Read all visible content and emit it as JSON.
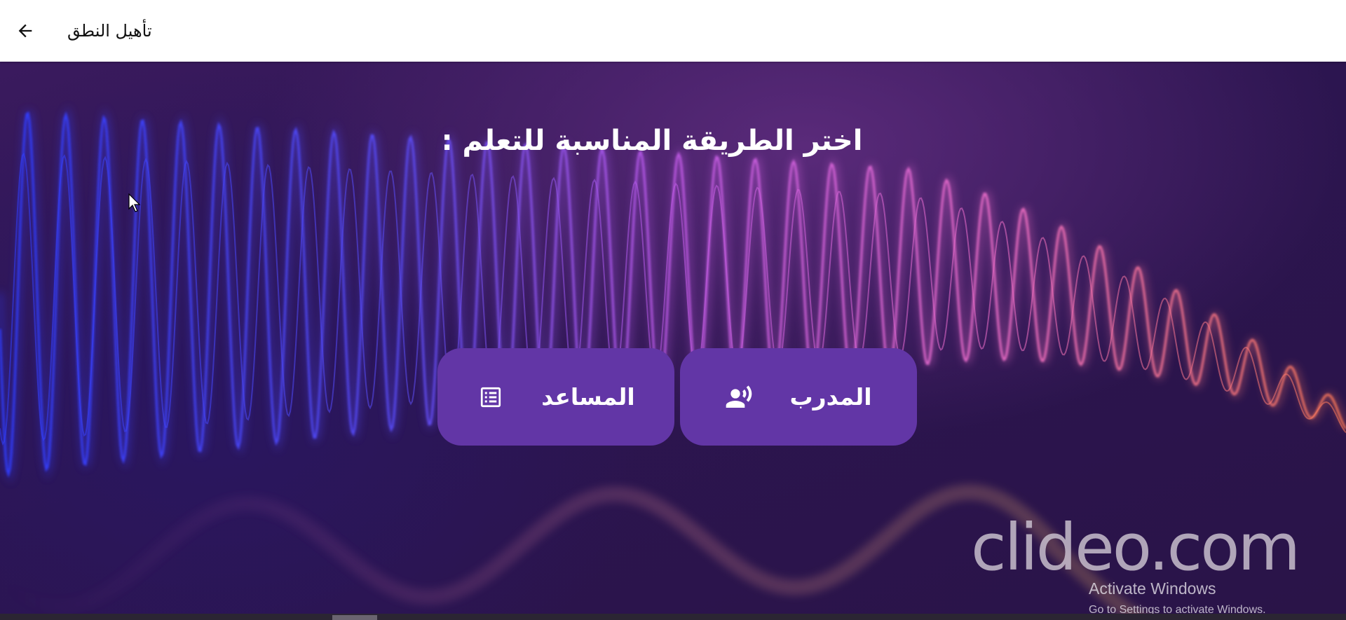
{
  "appbar": {
    "title": "تأهيل النطق",
    "back_icon": "arrow-left-icon"
  },
  "main": {
    "heading": "اختر الطريقة المناسبة للتعلم :",
    "buttons": [
      {
        "label": "المساعد",
        "icon": "list-document-icon"
      },
      {
        "label": "المدرب",
        "icon": "voice-person-icon"
      }
    ]
  },
  "watermark": {
    "text": "clideo.com"
  },
  "activation": {
    "title": "Activate Windows",
    "subtitle": "Go to Settings to activate Windows."
  },
  "colors": {
    "button_bg": "#6236a6",
    "background_dark": "#2c1550",
    "appbar_bg": "#ffffff"
  }
}
